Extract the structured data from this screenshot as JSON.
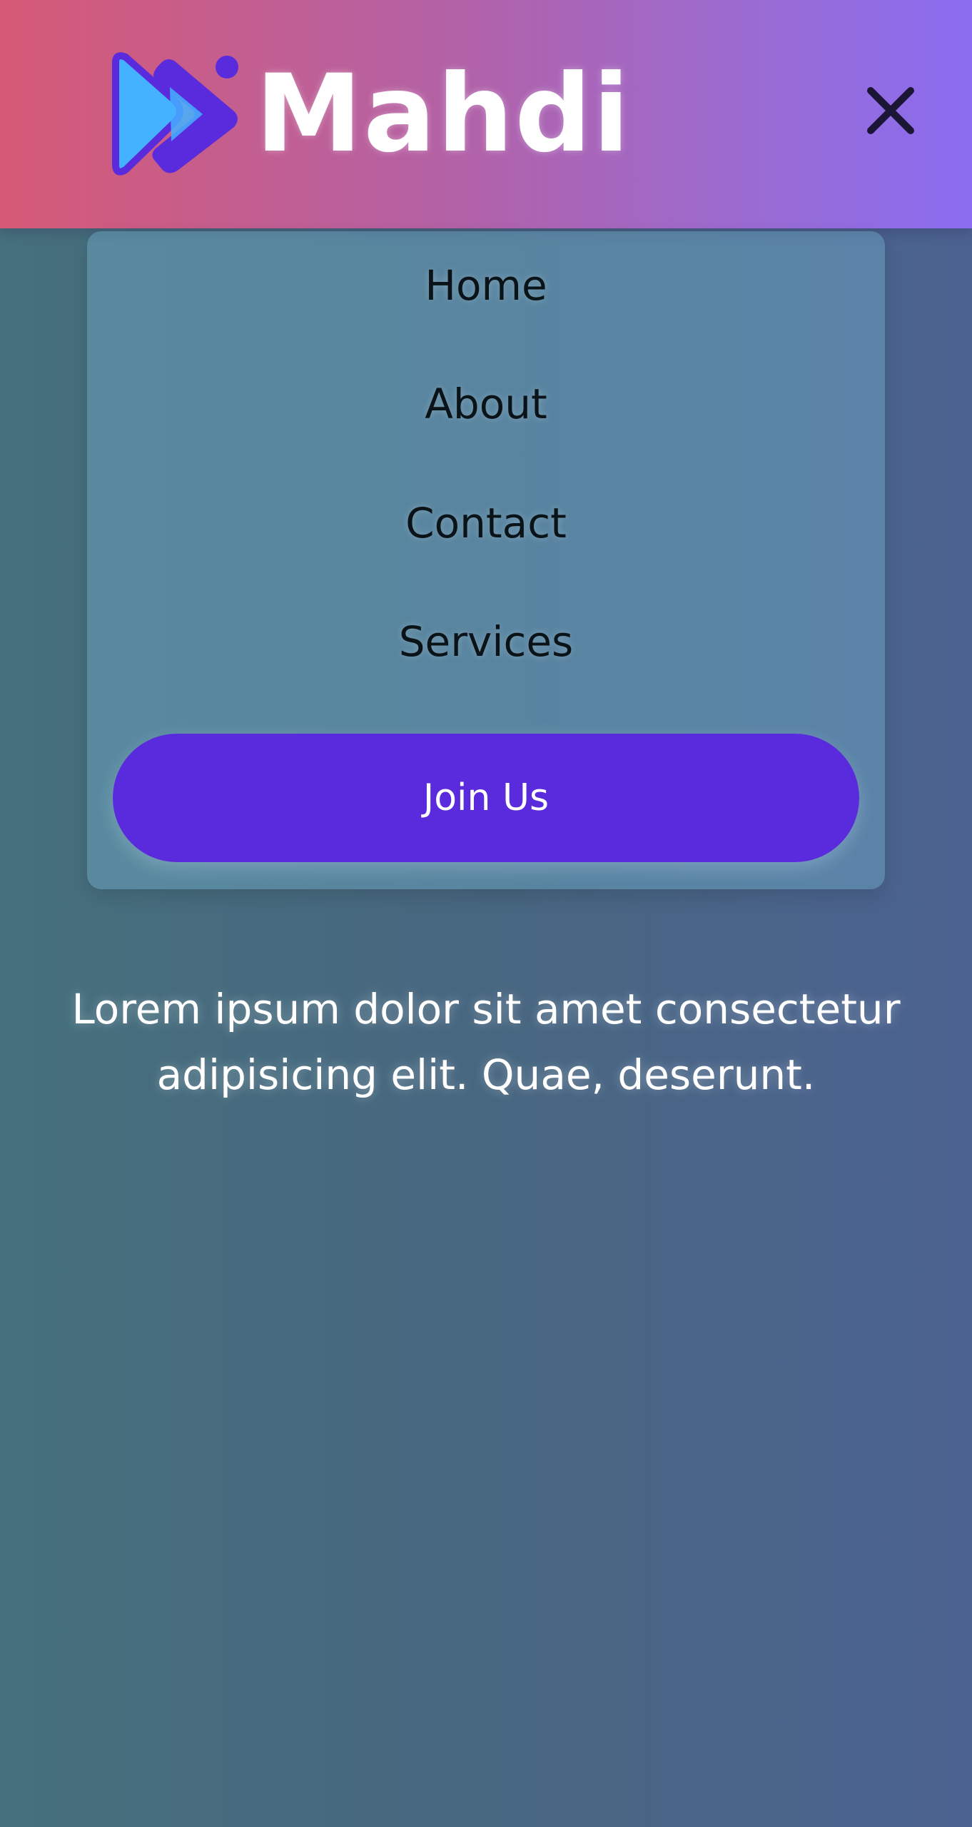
{
  "brand": {
    "name": "Mahdi",
    "icon": "brand-logo-icon",
    "colors": {
      "header_start": "#d65a76",
      "header_end": "#8a6cf0",
      "logo_primary": "#5a2bdc",
      "logo_secondary": "#45b2ff"
    }
  },
  "header": {
    "close_icon": "close-icon"
  },
  "menu": {
    "items": [
      {
        "label": "Home"
      },
      {
        "label": "About"
      },
      {
        "label": "Contact"
      },
      {
        "label": "Services"
      }
    ],
    "cta_label": "Join Us",
    "cta_color": "#5a2bdc"
  },
  "content": {
    "text": "Lorem ipsum dolor sit amet consectetur adipisicing elit. Quae, deserunt."
  }
}
